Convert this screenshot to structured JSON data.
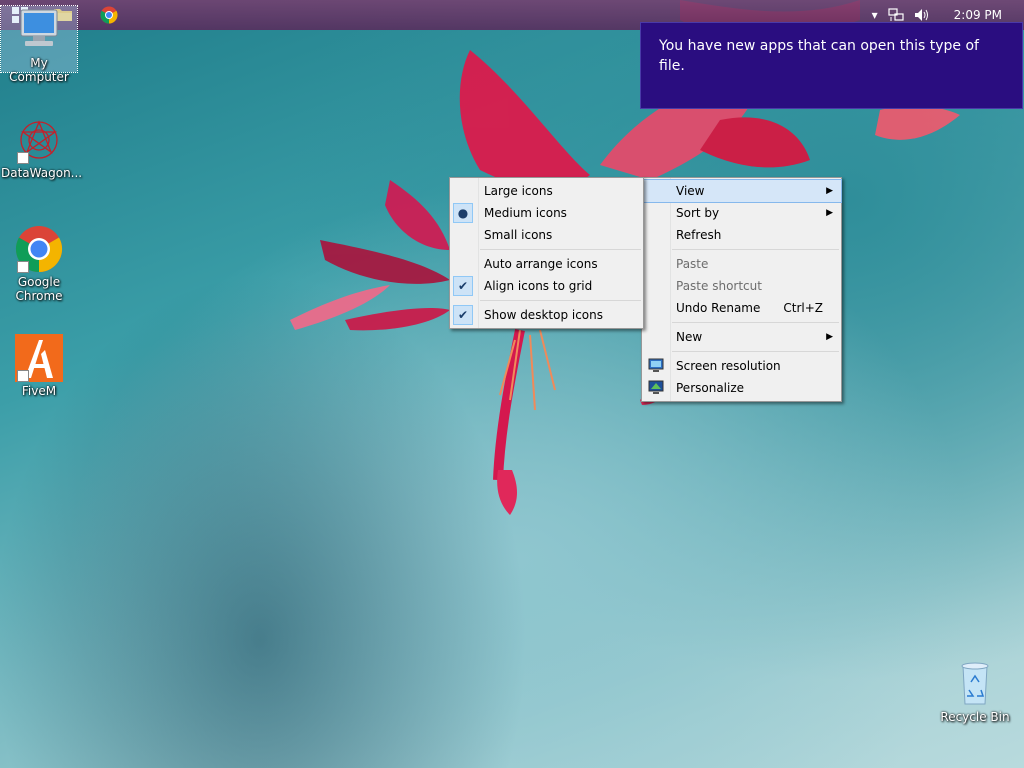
{
  "taskbar": {
    "time": "2:09 PM",
    "tray_up_arrow": "▾",
    "icons": [
      "start-icon",
      "folder-icon",
      "chrome-icon",
      "network-icon",
      "volume-icon"
    ]
  },
  "toast": {
    "message": "You have new apps that can open this type of file."
  },
  "desktop_icons": {
    "my_computer": "My Computer",
    "datawagon": "DataWagon...",
    "chrome_line1": "Google",
    "chrome_line2": "Chrome",
    "fivem": "FiveM",
    "recycle_bin": "Recycle Bin"
  },
  "context_menu": {
    "view": "View",
    "sort_by": "Sort by",
    "refresh": "Refresh",
    "paste": "Paste",
    "paste_shortcut": "Paste shortcut",
    "undo_rename": "Undo Rename",
    "undo_rename_shortcut": "Ctrl+Z",
    "new": "New",
    "screen_resolution": "Screen resolution",
    "personalize": "Personalize"
  },
  "view_submenu": {
    "large_icons": "Large icons",
    "medium_icons": "Medium icons",
    "small_icons": "Small icons",
    "auto_arrange": "Auto arrange icons",
    "align_to_grid": "Align icons to grid",
    "show_desktop_icons": "Show desktop icons",
    "checked": [
      "medium_icons",
      "align_to_grid",
      "show_desktop_icons"
    ]
  },
  "colors": {
    "toast_bg": "#2a0d80",
    "menu_bg": "#f0f0f0",
    "menu_highlight": "#d5e6f8"
  }
}
